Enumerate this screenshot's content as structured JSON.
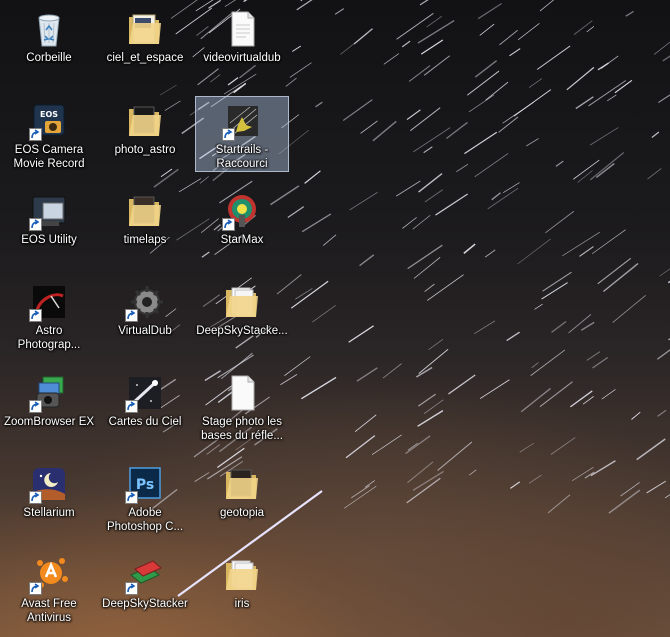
{
  "desktop": {
    "icons": [
      {
        "label": "Corbeille",
        "type": "recycle-bin"
      },
      {
        "label": "ciel_et_espace",
        "type": "folder"
      },
      {
        "label": "videovirtualdub",
        "type": "file"
      },
      {
        "label": "EOS Camera\nMovie Record",
        "type": "eos-app"
      },
      {
        "label": "photo_astro",
        "type": "folder"
      },
      {
        "label": "Startrails -\nRaccourci",
        "type": "startrails"
      },
      {
        "label": "EOS Utility",
        "type": "eos-utility"
      },
      {
        "label": "timelaps",
        "type": "folder"
      },
      {
        "label": "StarMax",
        "type": "starmax"
      },
      {
        "label": "Astro\nPhotograp...",
        "type": "astro"
      },
      {
        "label": "VirtualDub",
        "type": "virtualdub"
      },
      {
        "label": "DeepSkyStacke...",
        "type": "folder"
      },
      {
        "label": "ZoomBrowser EX",
        "type": "zoombrowser"
      },
      {
        "label": "Cartes du Ciel",
        "type": "cartes"
      },
      {
        "label": "Stage photo les\nbases du réfle...",
        "type": "file"
      },
      {
        "label": "Stellarium",
        "type": "stellarium"
      },
      {
        "label": "Adobe\nPhotoshop C...",
        "type": "photoshop"
      },
      {
        "label": "geotopia",
        "type": "folder"
      },
      {
        "label": "Avast Free\nAntivirus",
        "type": "avast"
      },
      {
        "label": "DeepSkyStacker",
        "type": "deepskystacker"
      },
      {
        "label": "iris",
        "type": "folder"
      }
    ]
  }
}
